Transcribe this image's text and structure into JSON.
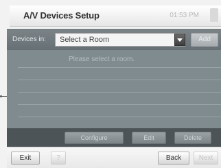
{
  "window": {
    "title": "A/V Devices Setup",
    "time": "01:53 PM"
  },
  "devices_row": {
    "label": "Devices in:",
    "select_value": "Select a Room",
    "add_label": "Add"
  },
  "main": {
    "message": "Please select a room.",
    "row_count": 5
  },
  "action_bar": {
    "buttons": [
      {
        "label": "Configure"
      },
      {
        "label": "Edit"
      },
      {
        "label": "Delete"
      }
    ]
  },
  "footer": {
    "exit_label": "Exit",
    "help_label": "?",
    "back_label": "Back",
    "next_label": "Next"
  },
  "colors": {
    "panel": "#7f8b8f",
    "action_bar": "#4c5457",
    "title_bar": "#eeeeee"
  }
}
